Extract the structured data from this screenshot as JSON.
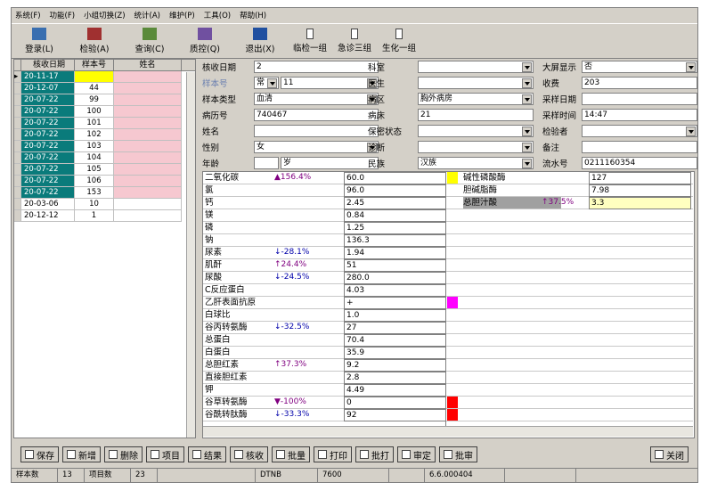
{
  "menu": [
    "系统(F)",
    "功能(F)",
    "小组切换(Z)",
    "统计(A)",
    "维护(P)",
    "工具(O)",
    "帮助(H)"
  ],
  "toolbar": [
    {
      "label": "登录(L)",
      "icon": "login-icon"
    },
    {
      "label": "检验(A)",
      "icon": "test-icon"
    },
    {
      "label": "查询(C)",
      "icon": "query-icon"
    },
    {
      "label": "质控(Q)",
      "icon": "qc-icon"
    },
    {
      "label": "退出(X)",
      "icon": "exit-icon"
    },
    {
      "label": "临检一组",
      "icon": "tube-icon"
    },
    {
      "label": "急诊三组",
      "icon": "tube-icon"
    },
    {
      "label": "生化一组",
      "icon": "tube-icon"
    }
  ],
  "list": {
    "headers": [
      "核收日期",
      "样本号",
      "姓名"
    ],
    "rows": [
      {
        "date": "20-11-17",
        "id": "",
        "teal": true,
        "sel": true
      },
      {
        "date": "20-12-07",
        "id": "44",
        "teal": true
      },
      {
        "date": "20-07-22",
        "id": "99",
        "teal": true
      },
      {
        "date": "20-07-22",
        "id": "100",
        "teal": true
      },
      {
        "date": "20-07-22",
        "id": "101",
        "teal": true
      },
      {
        "date": "20-07-22",
        "id": "102",
        "teal": true
      },
      {
        "date": "20-07-22",
        "id": "103",
        "teal": true
      },
      {
        "date": "20-07-22",
        "id": "104",
        "teal": true
      },
      {
        "date": "20-07-22",
        "id": "105",
        "teal": true
      },
      {
        "date": "20-07-22",
        "id": "106",
        "teal": true
      },
      {
        "date": "20-07-22",
        "id": "153",
        "teal": true
      },
      {
        "date": "20-03-06",
        "id": "10",
        "teal": false
      },
      {
        "date": "20-12-12",
        "id": "1",
        "teal": false
      }
    ]
  },
  "form": {
    "核收日期": "2",
    "样本号_prefix": "常",
    "样本号": "11",
    "样本类型": "血清",
    "病历号": "740467",
    "姓名": "",
    "性别": "女",
    "年龄": "",
    "年龄单位": "岁",
    "科室": "",
    "医生": "",
    "病区": "胸外病房",
    "病床": "21",
    "保密状态": "",
    "诊断": "",
    "民族": "汉族",
    "大屏显示": "否",
    "收费": "203",
    "采样日期": "",
    "采样时间": "14:47",
    "检验者": "",
    "备注": "",
    "流水号": "0211160354"
  },
  "labels": {
    "date": "核收日期",
    "sample_no": "样本号",
    "sample_type": "样本类型",
    "record_no": "病历号",
    "name": "姓名",
    "sex": "性别",
    "age": "年龄",
    "dept": "科室",
    "doctor": "医生",
    "ward": "病区",
    "bed": "病床",
    "secret": "保密状态",
    "diag": "诊断",
    "nation": "民族",
    "screen": "大屏显示",
    "fee": "收费",
    "sdate": "采样日期",
    "stime": "采样时间",
    "tester": "检验者",
    "remark": "备注",
    "serial": "流水号"
  },
  "results": [
    {
      "name": "二氧化碳",
      "flag": "▲156.4%",
      "dir": "up",
      "value": "60.0",
      "mk": "hh"
    },
    {
      "name": "氯",
      "flag": "",
      "value": "96.0"
    },
    {
      "name": "钙",
      "flag": "",
      "value": "2.45"
    },
    {
      "name": "镁",
      "flag": "",
      "value": "0.84"
    },
    {
      "name": "磷",
      "flag": "",
      "value": "1.25"
    },
    {
      "name": "钠",
      "flag": "",
      "value": "136.3"
    },
    {
      "name": "尿素",
      "flag": "↓-28.1%",
      "dir": "dn",
      "value": "1.94"
    },
    {
      "name": "肌酐",
      "flag": "↑24.4%",
      "dir": "up",
      "value": "51"
    },
    {
      "name": "尿酸",
      "flag": "↓-24.5%",
      "dir": "dn",
      "value": "280.0"
    },
    {
      "name": "C反应蛋白",
      "flag": "",
      "value": "4.03"
    },
    {
      "name": "乙肝表面抗原",
      "flag": "",
      "value": "+",
      "mk": "pink"
    },
    {
      "name": "白球比",
      "flag": "",
      "value": "1.0"
    },
    {
      "name": "谷丙转氨酶",
      "flag": "↓-32.5%",
      "dir": "dn",
      "value": "27"
    },
    {
      "name": "总蛋白",
      "flag": "",
      "value": "70.4"
    },
    {
      "name": "白蛋白",
      "flag": "",
      "value": "35.9"
    },
    {
      "name": "总胆红素",
      "flag": "↑37.3%",
      "dir": "up",
      "value": "9.2"
    },
    {
      "name": "直接胆红素",
      "flag": "",
      "value": "2.8"
    },
    {
      "name": "钾",
      "flag": "",
      "value": "4.49"
    },
    {
      "name": "谷草转氨酶",
      "flag": "▼-100%",
      "dir": "up",
      "value": "0",
      "mk": "red"
    },
    {
      "name": "谷酰转肽酶",
      "flag": "↓-33.3%",
      "dir": "dn",
      "value": "92",
      "mk": "red"
    }
  ],
  "results2": [
    {
      "name": "碱性磷酸酶",
      "flag": "",
      "value": "127",
      "mk": "red"
    },
    {
      "name": "胆碱脂酶",
      "flag": "",
      "value": "7.98"
    },
    {
      "name": "总胆汁酸",
      "flag": "↑37.5%",
      "value": "3.3",
      "sel": true
    }
  ],
  "buttons": [
    "保存",
    "新增",
    "删除",
    "项目",
    "结果",
    "核收",
    "批量",
    "打印",
    "批打",
    "审定",
    "批审",
    "关闭"
  ],
  "status": [
    "样本数",
    "13",
    "项目数",
    "23",
    "",
    "DTNB",
    "7600",
    "",
    "6.6.000404",
    ""
  ]
}
